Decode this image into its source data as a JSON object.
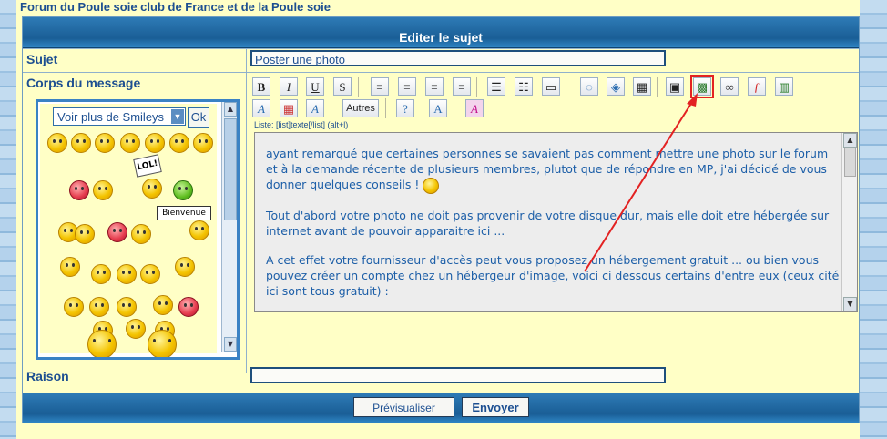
{
  "breadcrumb": "Forum du Poule soie club de France et de la Poule soie",
  "form_title": "Editer le sujet",
  "subject": {
    "label": "Sujet",
    "value": "Poster une photo"
  },
  "body": {
    "label": "Corps du message",
    "smiley_select": "Voir plus de Smileys",
    "ok_label": "Ok",
    "lol_sign": "LOL!",
    "bienvenue_sign": "Bienvenue",
    "list_hint": "Liste: [list]texte[/list] (alt+l)",
    "autres_label": "Autres",
    "paragraphs": [
      "ayant remarqué que certaines personnes se savaient pas comment mettre une photo sur le forum et à la demande récente de plusieurs membres, plutot que de répondre en MP, j'ai décidé de vous donner quelques conseils !",
      "Tout d'abord votre photo ne doit pas provenir de votre disque dur, mais elle doit etre hébergée sur internet avant de pouvoir apparaitre ici ...",
      "A cet effet votre fournisseur d'accès peut vous proposez un hébergement gratuit ... ou bien vous pouvez créer un compte chez un hébergeur d'image, voici ci dessous certains d'entre eux (ceux cité ici sont tous gratuit) :"
    ]
  },
  "toolbar": {
    "bold": "B",
    "italic": "I",
    "underline": "U",
    "strike": "S",
    "icons": [
      "align-left-icon",
      "align-center-icon",
      "align-right-icon",
      "align-justify-icon",
      "bullet-list-icon",
      "numbered-list-icon",
      "horizontal-rule-icon",
      "quote-icon",
      "code-icon",
      "table-icon",
      "spoiler-icon",
      "image-icon",
      "link-icon",
      "flash-icon",
      "video-icon"
    ]
  },
  "reason": {
    "label": "Raison",
    "value": ""
  },
  "buttons": {
    "preview": "Prévisualiser",
    "submit": "Envoyer"
  },
  "colors": {
    "accent": "#1a5e96",
    "background": "#ffffc6",
    "highlight": "#e32222",
    "text": "#1d4f91"
  }
}
